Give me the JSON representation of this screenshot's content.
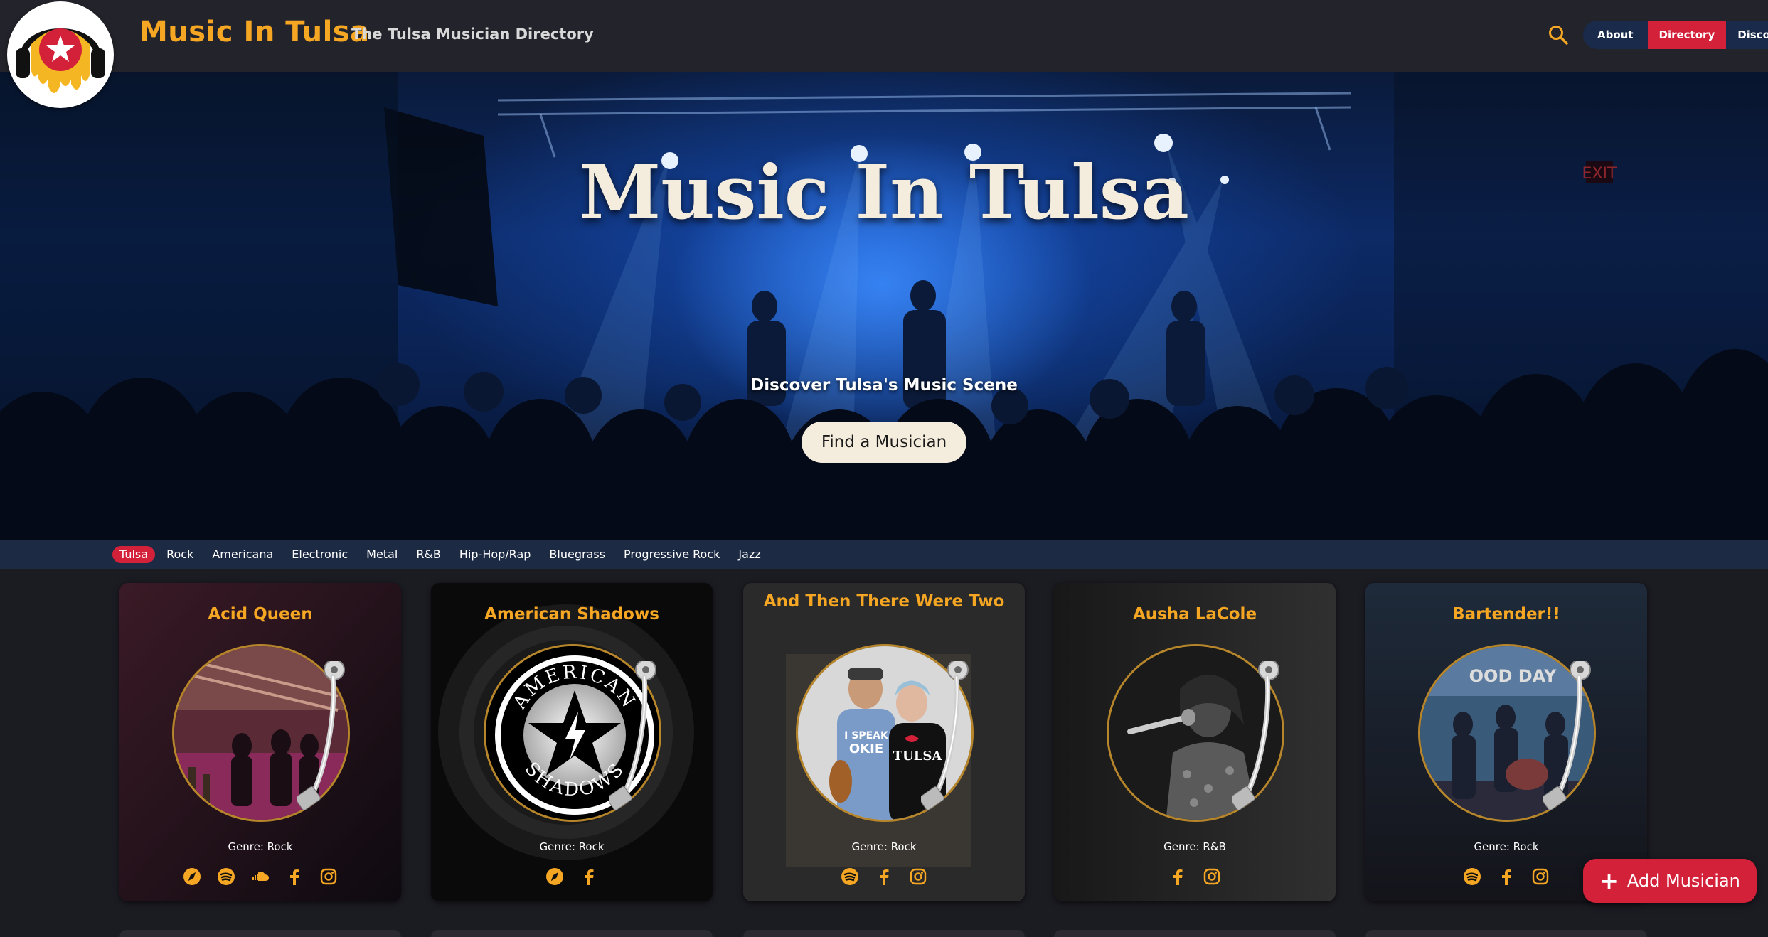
{
  "header": {
    "brand": "Music In Tulsa",
    "tagline": "The Tulsa Musician Directory",
    "search_icon": "search-icon",
    "nav": [
      {
        "label": "About",
        "active": false
      },
      {
        "label": "Directory",
        "active": true
      },
      {
        "label": "Discover",
        "active": false
      }
    ]
  },
  "hero": {
    "title": "Music In Tulsa",
    "subtitle": "Discover Tulsa's Music Scene",
    "cta": "Find a Musician"
  },
  "filters": [
    {
      "label": "Tulsa",
      "active": true
    },
    {
      "label": "Rock"
    },
    {
      "label": "Americana"
    },
    {
      "label": "Electronic"
    },
    {
      "label": "Metal"
    },
    {
      "label": "R&B"
    },
    {
      "label": "Hip-Hop/Rap"
    },
    {
      "label": "Bluegrass"
    },
    {
      "label": "Progressive Rock"
    },
    {
      "label": "Jazz"
    }
  ],
  "cards": [
    {
      "name": "Acid Queen",
      "genre": "Genre: Rock",
      "socials": [
        "compass-icon",
        "spotify-icon",
        "soundcloud-icon",
        "facebook-icon",
        "instagram-icon"
      ]
    },
    {
      "name": "American Shadows",
      "genre": "Genre: Rock",
      "socials": [
        "compass-icon",
        "facebook-icon"
      ],
      "logo_text_top": "AMERICAN",
      "logo_text_bottom": "SHADOWS"
    },
    {
      "name": "And Then There Were Two",
      "genre": "Genre: Rock",
      "socials": [
        "spotify-icon",
        "facebook-icon",
        "instagram-icon"
      ]
    },
    {
      "name": "Ausha LaCole",
      "genre": "Genre: R&B",
      "socials": [
        "facebook-icon",
        "instagram-icon"
      ]
    },
    {
      "name": "Bartender!!",
      "genre": "Genre: Rock",
      "socials": [
        "spotify-icon",
        "facebook-icon",
        "instagram-icon"
      ]
    }
  ],
  "add_button": "Add Musician",
  "colors": {
    "accent": "#f5a623",
    "brand_red": "#d4213a",
    "nav_bg": "#1a2a4a",
    "cream": "#f4ecdc"
  }
}
